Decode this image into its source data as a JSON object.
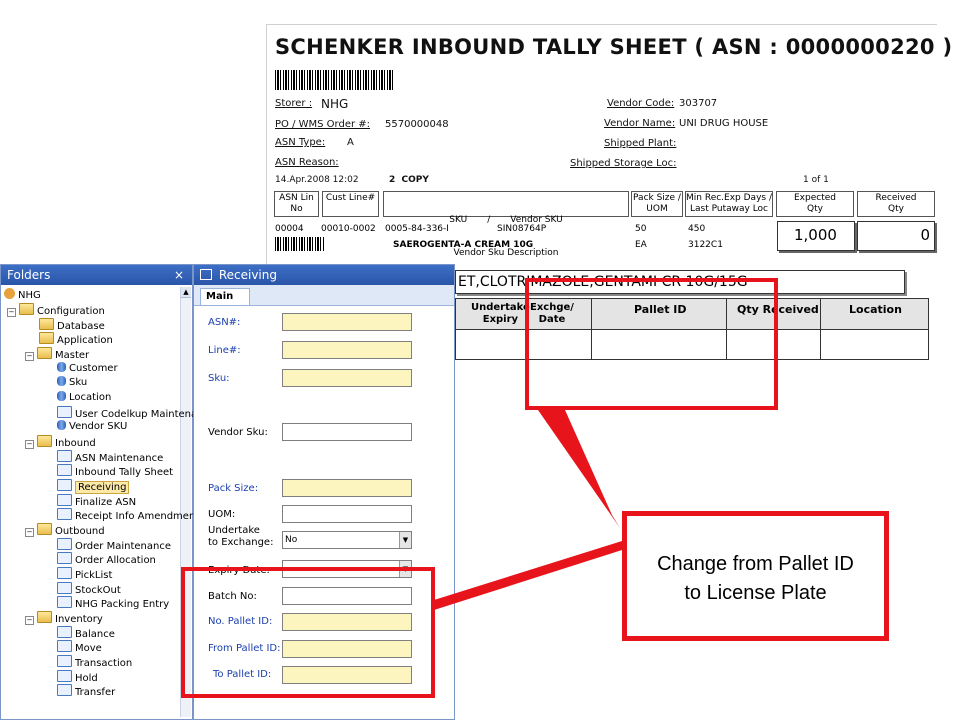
{
  "report": {
    "title": "SCHENKER INBOUND TALLY SHEET ( ASN : 0000000220 )",
    "storer_label": "Storer :",
    "storer_value": "NHG",
    "po_label": "PO / WMS Order #:",
    "po_value": "5570000048",
    "asn_type_label": "ASN Type:",
    "asn_type_value": "A",
    "asn_reason_label": "ASN Reason:",
    "vendor_code_label": "Vendor Code:",
    "vendor_code_value": "303707",
    "vendor_name_label": "Vendor Name:",
    "vendor_name_value": "UNI DRUG HOUSE",
    "shipped_plant_label": "Shipped Plant:",
    "shipped_storage_label": "Shipped Storage Loc:",
    "date_value": "14.Apr.2008 12:02",
    "copy_value": "2  COPY",
    "page_value": "1 of 1",
    "headers": {
      "asn_line": [
        "ASN Lin",
        "No"
      ],
      "cust_line": [
        "Cust Line#",
        ""
      ],
      "sku": [
        "SKU       /       Vendor SKU",
        "Vendor Sku Description"
      ],
      "pack": [
        "Pack Size /",
        "UOM"
      ],
      "minrec": [
        "Min Rec.Exp Days /",
        "Last Putaway Loc"
      ],
      "expected": [
        "Expected",
        "Qty"
      ],
      "received": [
        "Received",
        "Qty"
      ]
    },
    "line": {
      "asn_line": "00004",
      "cust_line": "00010-0002",
      "sku": "0005-84-336-I",
      "vendor_sku": "SIN08764P",
      "description": "SAEROGENTA-A CREAM 10G",
      "pack_size": "50",
      "uom": "EA",
      "min_rec": "450",
      "last_loc": "3122C1",
      "expected_qty": "1,000",
      "received_qty": "0"
    },
    "lower_banner": "ET,CLOTRIMAZOLE,GENTAMI CR 10G/15G",
    "lower_headers": {
      "undertake": [
        "Undertake",
        "Expiry"
      ],
      "exchange": [
        "Exchge/",
        "Date"
      ],
      "pallet_id": "Pallet ID",
      "qty_received": "Qty Received",
      "location": "Location"
    }
  },
  "folders": {
    "title": "Folders",
    "close_glyph": "×",
    "items": [
      {
        "label": "NHG"
      },
      {
        "label": "Configuration"
      },
      {
        "label": "Database"
      },
      {
        "label": "Application"
      },
      {
        "label": "Master"
      },
      {
        "label": "Customer"
      },
      {
        "label": "Sku"
      },
      {
        "label": "Location"
      },
      {
        "label": "User Codelkup Maintena"
      },
      {
        "label": "Vendor SKU"
      },
      {
        "label": "Inbound"
      },
      {
        "label": "ASN Maintenance"
      },
      {
        "label": "Inbound Tally Sheet"
      },
      {
        "label": "Receiving"
      },
      {
        "label": "Finalize ASN"
      },
      {
        "label": "Receipt Info Amendmen"
      },
      {
        "label": "Outbound"
      },
      {
        "label": "Order Maintenance"
      },
      {
        "label": "Order Allocation"
      },
      {
        "label": "PickList"
      },
      {
        "label": "StockOut"
      },
      {
        "label": "NHG Packing Entry"
      },
      {
        "label": "Inventory"
      },
      {
        "label": "Balance"
      },
      {
        "label": "Move"
      },
      {
        "label": "Transaction"
      },
      {
        "label": "Hold"
      },
      {
        "label": "Transfer"
      }
    ]
  },
  "receiving": {
    "title": "Receiving",
    "tab_main": "Main",
    "fields": {
      "asn": "ASN#:",
      "line": "Line#:",
      "sku": "Sku:",
      "vendor_sku": "Vendor Sku:",
      "pack_size": "Pack Size:",
      "uom": "UOM:",
      "undertake1": "Undertake",
      "undertake2": "to Exchange:",
      "undertake_value": "No",
      "expiry": "Expiry Date:",
      "batch": "Batch No:",
      "no_pallet": "No. Pallet ID:",
      "from_pallet": "From Pallet ID:",
      "to_pallet": "To Pallet ID:"
    }
  },
  "callout": {
    "line1": "Change from Pallet ID",
    "line2": "to License Plate"
  },
  "colors": {
    "highlight_red": "#e8141b",
    "required_label_blue": "#1b3fae",
    "required_field_yellow": "#fdf5c0",
    "panel_header_blue": "#2a55a8"
  }
}
